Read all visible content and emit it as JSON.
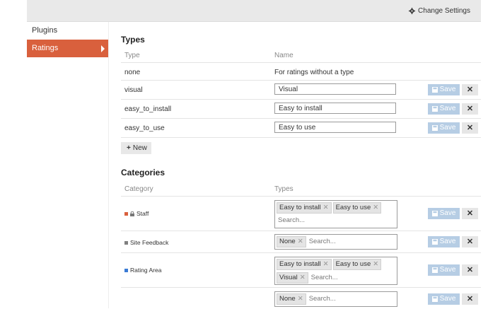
{
  "header": {
    "change_settings": "Change Settings"
  },
  "sidebar": {
    "items": [
      {
        "label": "Plugins"
      },
      {
        "label": "Ratings"
      }
    ]
  },
  "types": {
    "title": "Types",
    "col_type": "Type",
    "col_name": "Name",
    "rows": [
      {
        "type": "none",
        "name": "For ratings without a type"
      },
      {
        "type": "visual",
        "name": "Visual"
      },
      {
        "type": "easy_to_install",
        "name": "Easy to install"
      },
      {
        "type": "easy_to_use",
        "name": "Easy to use"
      }
    ],
    "new_label": "New",
    "save_label": "Save",
    "delete_label": "✕"
  },
  "categories": {
    "title": "Categories",
    "col_category": "Category",
    "col_types": "Types",
    "search_placeholder": "Search...",
    "rows": [
      {
        "label": "Staff",
        "color": "#d9603d",
        "locked": true,
        "tags": [
          "Easy to install",
          "Easy to use"
        ]
      },
      {
        "label": "Site Feedback",
        "color": "#808080",
        "locked": false,
        "tags": [
          "None"
        ]
      },
      {
        "label": "Rating Area",
        "color": "#3a7bd5",
        "locked": false,
        "tags": [
          "Easy to install",
          "Easy to use",
          "Visual"
        ]
      },
      {
        "label": "",
        "color": "",
        "locked": false,
        "tags": [
          "None"
        ]
      }
    ]
  }
}
